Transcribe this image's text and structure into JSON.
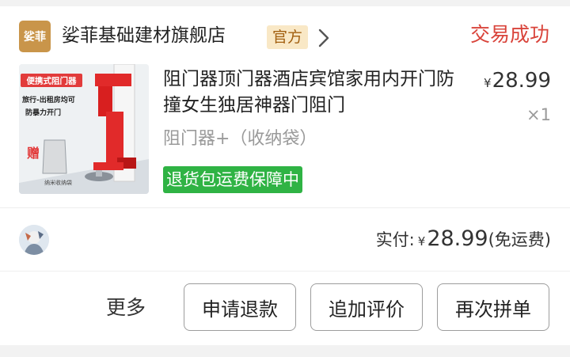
{
  "store": {
    "logo_text": "娑菲",
    "name": "娑菲基础建材旗舰店",
    "badge": "官方",
    "status": "交易成功"
  },
  "product": {
    "image_label": "便携式阻门器",
    "image_caption_1": "旅行-出租房均可",
    "image_caption_2": "防暴力开门",
    "image_gift": "赠",
    "image_bag_label": "纳米收纳袋",
    "title": "阻门器顶门器酒店宾馆家用内开门防撞女生独居神器门阻门",
    "spec": "阻门器+（收纳袋）",
    "return_badge": "退货包运费保障中",
    "price_symbol": "¥",
    "price": "28.99",
    "quantity": "×1"
  },
  "summary": {
    "paid_label": "实付:",
    "paid_symbol": "¥",
    "paid_amount": "28.99",
    "shipping_note": "(免运费)"
  },
  "actions": {
    "more": "更多",
    "refund": "申请退款",
    "add_review": "追加评价",
    "rebuy": "再次拼单"
  },
  "colors": {
    "status_red": "#d9443b",
    "badge_green": "#2fb344",
    "logo_gold": "#c9954a",
    "official_bg": "#f9e8c6"
  }
}
